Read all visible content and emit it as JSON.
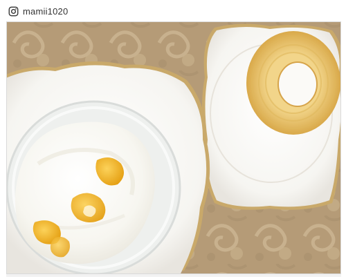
{
  "header": {
    "username": "mamii1020",
    "icon": "instagram-icon"
  },
  "photo": {
    "subject": "photo",
    "colors": {
      "tablecloth": "#b9a07c",
      "plate": "#fbfbf9",
      "gold_rim": "#c9a96a",
      "yogurt": "#fbfaf5",
      "mango": "#f0b21a",
      "baumkuchen": "#e9c774"
    }
  }
}
